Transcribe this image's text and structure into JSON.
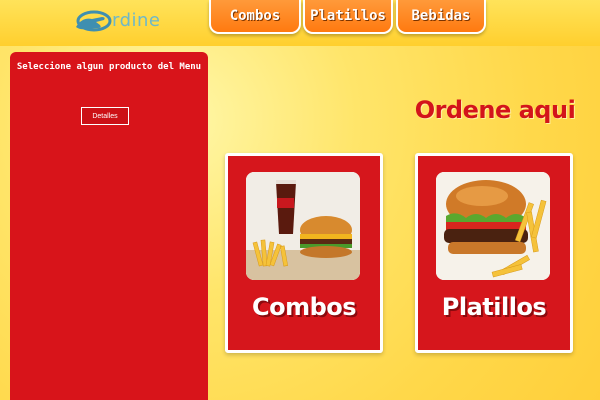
{
  "header": {
    "logo_text": "rdine",
    "tabs": [
      {
        "label": "Combos"
      },
      {
        "label": "Platillos"
      },
      {
        "label": "Bebidas"
      }
    ]
  },
  "sidebar": {
    "message": "Seleccione algun producto del Menu",
    "details_button": "Detalles"
  },
  "main": {
    "headline": "Ordene aqui",
    "cards": [
      {
        "label": "Combos",
        "image": "combo-meal-photo"
      },
      {
        "label": "Platillos",
        "image": "burger-fries-photo"
      }
    ]
  },
  "colors": {
    "primary_red": "#d6161c",
    "tab_orange": "#ff8a20",
    "background_yellow": "#ffe06a",
    "logo_teal": "#6fb8c8"
  }
}
